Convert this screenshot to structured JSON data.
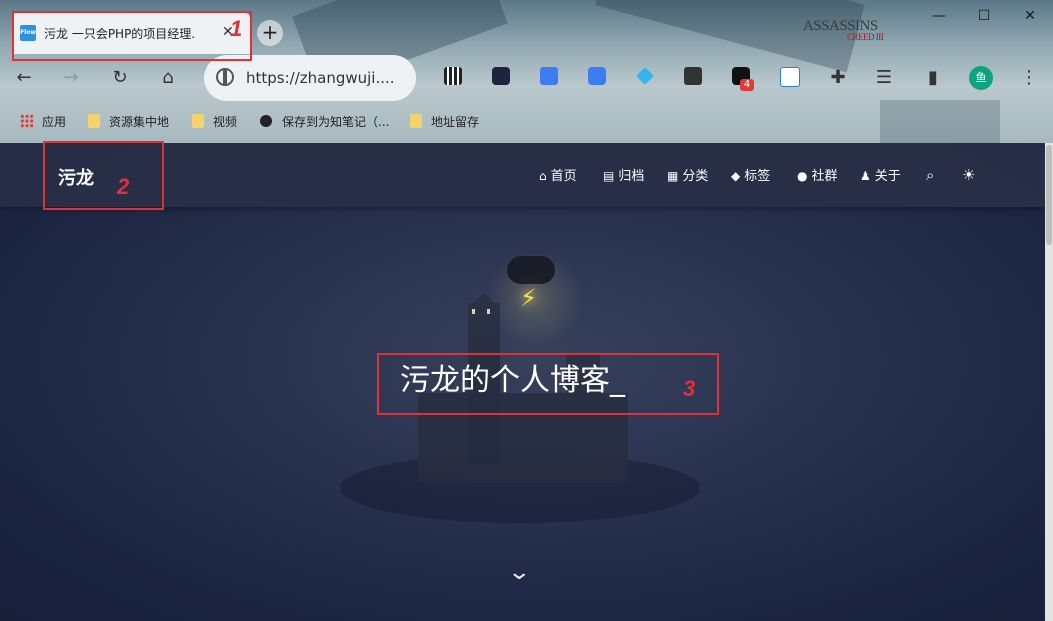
{
  "browser": {
    "tab": {
      "title": "污龙 一只会PHP的项目经理.",
      "favicon": "Flow"
    },
    "new_tab_label": "+",
    "theme_logo": {
      "line1": "ASSASSINS",
      "line2": "CREED III"
    },
    "address": {
      "url": "https://zhangwuji...."
    },
    "extension_badge": "4",
    "profile_avatar": "鱼",
    "bookmarks": [
      {
        "label": "应用",
        "icon": "apps-icon"
      },
      {
        "label": "资源集中地",
        "icon": "folder-icon"
      },
      {
        "label": "视频",
        "icon": "folder-icon"
      },
      {
        "label": "保存到为知笔记（...",
        "icon": "github-icon"
      },
      {
        "label": "地址留存",
        "icon": "folder-icon"
      }
    ]
  },
  "site": {
    "title": "污龙",
    "nav": [
      {
        "label": "首页",
        "icon": "home-icon"
      },
      {
        "label": "归档",
        "icon": "archive-icon"
      },
      {
        "label": "分类",
        "icon": "category-icon"
      },
      {
        "label": "标签",
        "icon": "tag-icon"
      },
      {
        "label": "社群",
        "icon": "chat-icon"
      },
      {
        "label": "关于",
        "icon": "user-icon"
      }
    ],
    "hero_text": "污龙的个人博客_"
  },
  "annotations": {
    "n1": "1",
    "n2": "2",
    "n3": "3",
    "color": "#e0303a"
  }
}
